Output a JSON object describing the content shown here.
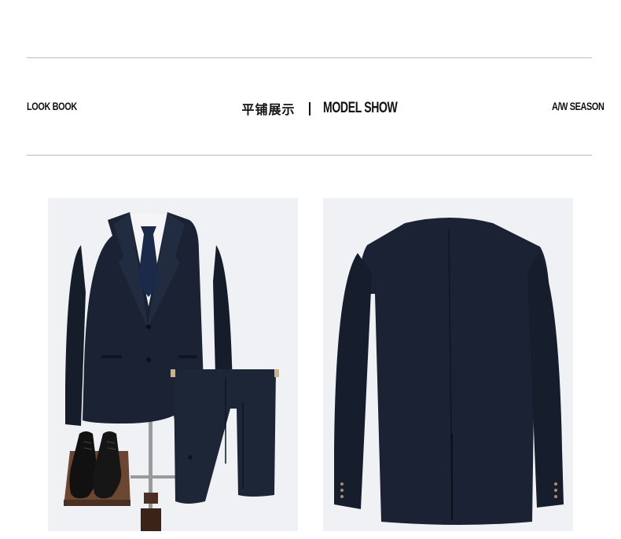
{
  "header": {
    "left_label": "LOOK BOOK",
    "title_cn": "平铺展示",
    "title_en": "MODEL SHOW",
    "right_label": "A/W SEASON"
  },
  "colors": {
    "rule": "#bdbdbd",
    "photo_background": "#eff1f4",
    "suit_navy": "#1a2233",
    "shirt": "#f5f5f7",
    "tie": "#1c2a4a",
    "shoe": "#111111",
    "stand_wood": "#4a2f22"
  },
  "photos": [
    {
      "subject": "suit-front-with-trousers-and-shoes"
    },
    {
      "subject": "suit-jacket-back"
    }
  ]
}
